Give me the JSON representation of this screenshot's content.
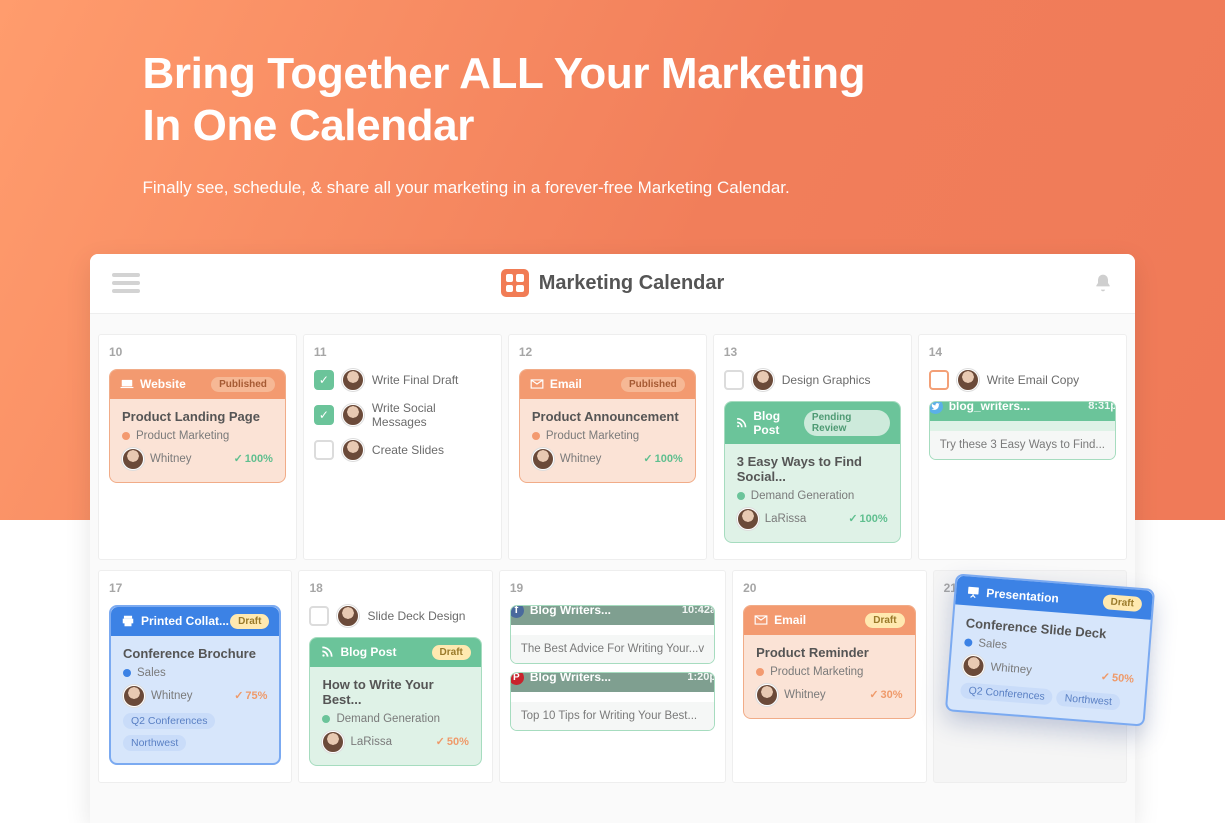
{
  "hero": {
    "title_l1": "Bring Together ALL Your Marketing",
    "title_l2": "In One Calendar",
    "subtitle": "Finally see, schedule, & share all your marketing in a forever-free Marketing Calendar."
  },
  "topbar": {
    "brand": "Marketing Calendar"
  },
  "days": {
    "d10": "10",
    "d11": "11",
    "d12": "12",
    "d13": "13",
    "d14": "14",
    "d17": "17",
    "d18": "18",
    "d19": "19",
    "d20": "20",
    "d21": "21"
  },
  "tasks": {
    "t11a": "Write Final Draft",
    "t11b": "Write Social Messages",
    "t11c": "Create Slides",
    "t13a": "Design Graphics",
    "t14a": "Write Email Copy",
    "t18a": "Slide Deck Design"
  },
  "cards": {
    "website": {
      "kind": "Website",
      "status": "Published",
      "title": "Product Landing Page",
      "team": "Product Marketing",
      "owner": "Whitney",
      "pct": "100%"
    },
    "email12": {
      "kind": "Email",
      "status": "Published",
      "title": "Product Announcement",
      "team": "Product Marketing",
      "owner": "Whitney",
      "pct": "100%"
    },
    "blog13": {
      "kind": "Blog Post",
      "status": "Pending Review",
      "title": "3 Easy Ways to Find Social...",
      "team": "Demand Generation",
      "owner": "LaRissa",
      "pct": "100%"
    },
    "tweet14": {
      "kind": "blog_writers...",
      "time": "8:31p",
      "body": "Try these 3 Easy Ways to Find..."
    },
    "printed17": {
      "kind": "Printed Collat...",
      "status": "Draft",
      "title": "Conference Brochure",
      "team": "Sales",
      "owner": "Whitney",
      "pct": "75%",
      "tag1": "Q2 Conferences",
      "tag2": "Northwest"
    },
    "blog18": {
      "kind": "Blog Post",
      "status": "Draft",
      "title": "How to Write Your Best...",
      "team": "Demand Generation",
      "owner": "LaRissa",
      "pct": "50%"
    },
    "fb19": {
      "kind": "Blog Writers...",
      "time": "10:42a",
      "body": "The Best Advice For Writing Your...v"
    },
    "pin19": {
      "kind": "Blog Writers...",
      "time": "1:20p",
      "body": "Top 10 Tips for Writing Your Best..."
    },
    "email20": {
      "kind": "Email",
      "status": "Draft",
      "title": "Product Reminder",
      "team": "Product Marketing",
      "owner": "Whitney",
      "pct": "30%"
    },
    "pres21": {
      "kind": "Presentation",
      "status": "Draft",
      "title": "Conference Slide Deck",
      "team": "Sales",
      "owner": "Whitney",
      "pct": "50%",
      "tag1": "Q2 Conferences",
      "tag2": "Northwest"
    }
  }
}
